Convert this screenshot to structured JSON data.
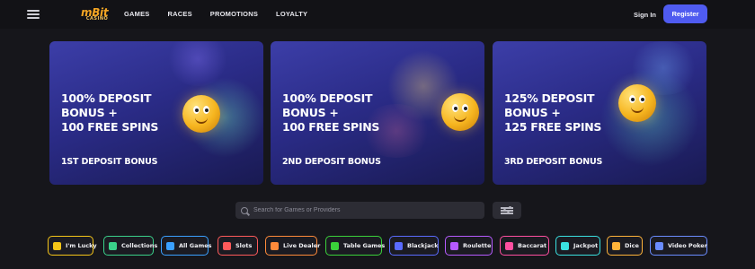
{
  "header": {
    "logo_text": "mBit",
    "logo_subtext": "CASINO",
    "nav": [
      "GAMES",
      "RACES",
      "PROMOTIONS",
      "LOYALTY"
    ],
    "signin_label": "Sign In",
    "register_label": "Register",
    "colors": {
      "accent": "#4f5bf0",
      "logo": "#f5a623"
    }
  },
  "promos": [
    {
      "line1": "100% DEPOSIT",
      "line2": "BONUS +",
      "line3": "100 FREE SPINS",
      "subtitle": "1ST DEPOSIT BONUS"
    },
    {
      "line1": "100% DEPOSIT",
      "line2": "BONUS +",
      "line3": "100 FREE SPINS",
      "subtitle": "2ND DEPOSIT BONUS"
    },
    {
      "line1": "125% DEPOSIT",
      "line2": "BONUS +",
      "line3": "125 FREE SPINS",
      "subtitle": "3RD DEPOSIT BONUS"
    }
  ],
  "search": {
    "placeholder": "Search for Games or Providers"
  },
  "categories": [
    {
      "label": "I'm Lucky",
      "icon": "clover-icon",
      "color": "#f5c518"
    },
    {
      "label": "Collections",
      "icon": "collections-icon",
      "color": "#3ad18a"
    },
    {
      "label": "All Games",
      "icon": "gamepad-icon",
      "color": "#3aa0ff"
    },
    {
      "label": "Slots",
      "icon": "slot-machine-icon",
      "color": "#ff5a5a"
    },
    {
      "label": "Live Dealer",
      "icon": "dealer-icon",
      "color": "#ff8a3a"
    },
    {
      "label": "Table Games",
      "icon": "dice-table-icon",
      "color": "#3ad13a"
    },
    {
      "label": "Blackjack",
      "icon": "cards-icon",
      "color": "#5a6bff"
    },
    {
      "label": "Roulette",
      "icon": "roulette-icon",
      "color": "#b65aff"
    },
    {
      "label": "Baccarat",
      "icon": "baccarat-icon",
      "color": "#ff4fa0"
    },
    {
      "label": "Jackpot",
      "icon": "jackpot-icon",
      "color": "#3ae0e0"
    },
    {
      "label": "Dice",
      "icon": "dice-icon",
      "color": "#ffb33a"
    },
    {
      "label": "Video Poker",
      "icon": "poker-chip-icon",
      "color": "#6a8cff"
    }
  ]
}
